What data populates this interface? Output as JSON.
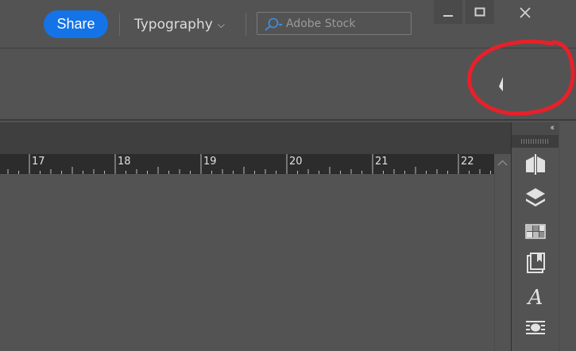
{
  "appbar": {
    "share_label": "Share",
    "workspace_label": "Typography",
    "search_placeholder": "Adobe Stock"
  },
  "ruler": {
    "marks": [
      "17",
      "18",
      "19",
      "20",
      "21",
      "22"
    ]
  },
  "dock": {
    "collapse_glyph": "‹‹",
    "panels": [
      "pages-icon",
      "layers-icon",
      "swatches-icon",
      "cc-libraries-icon",
      "character-styles-icon",
      "paragraph-styles-icon"
    ]
  },
  "colors": {
    "accent": "#1473e6",
    "annotation": "#e8202a"
  }
}
